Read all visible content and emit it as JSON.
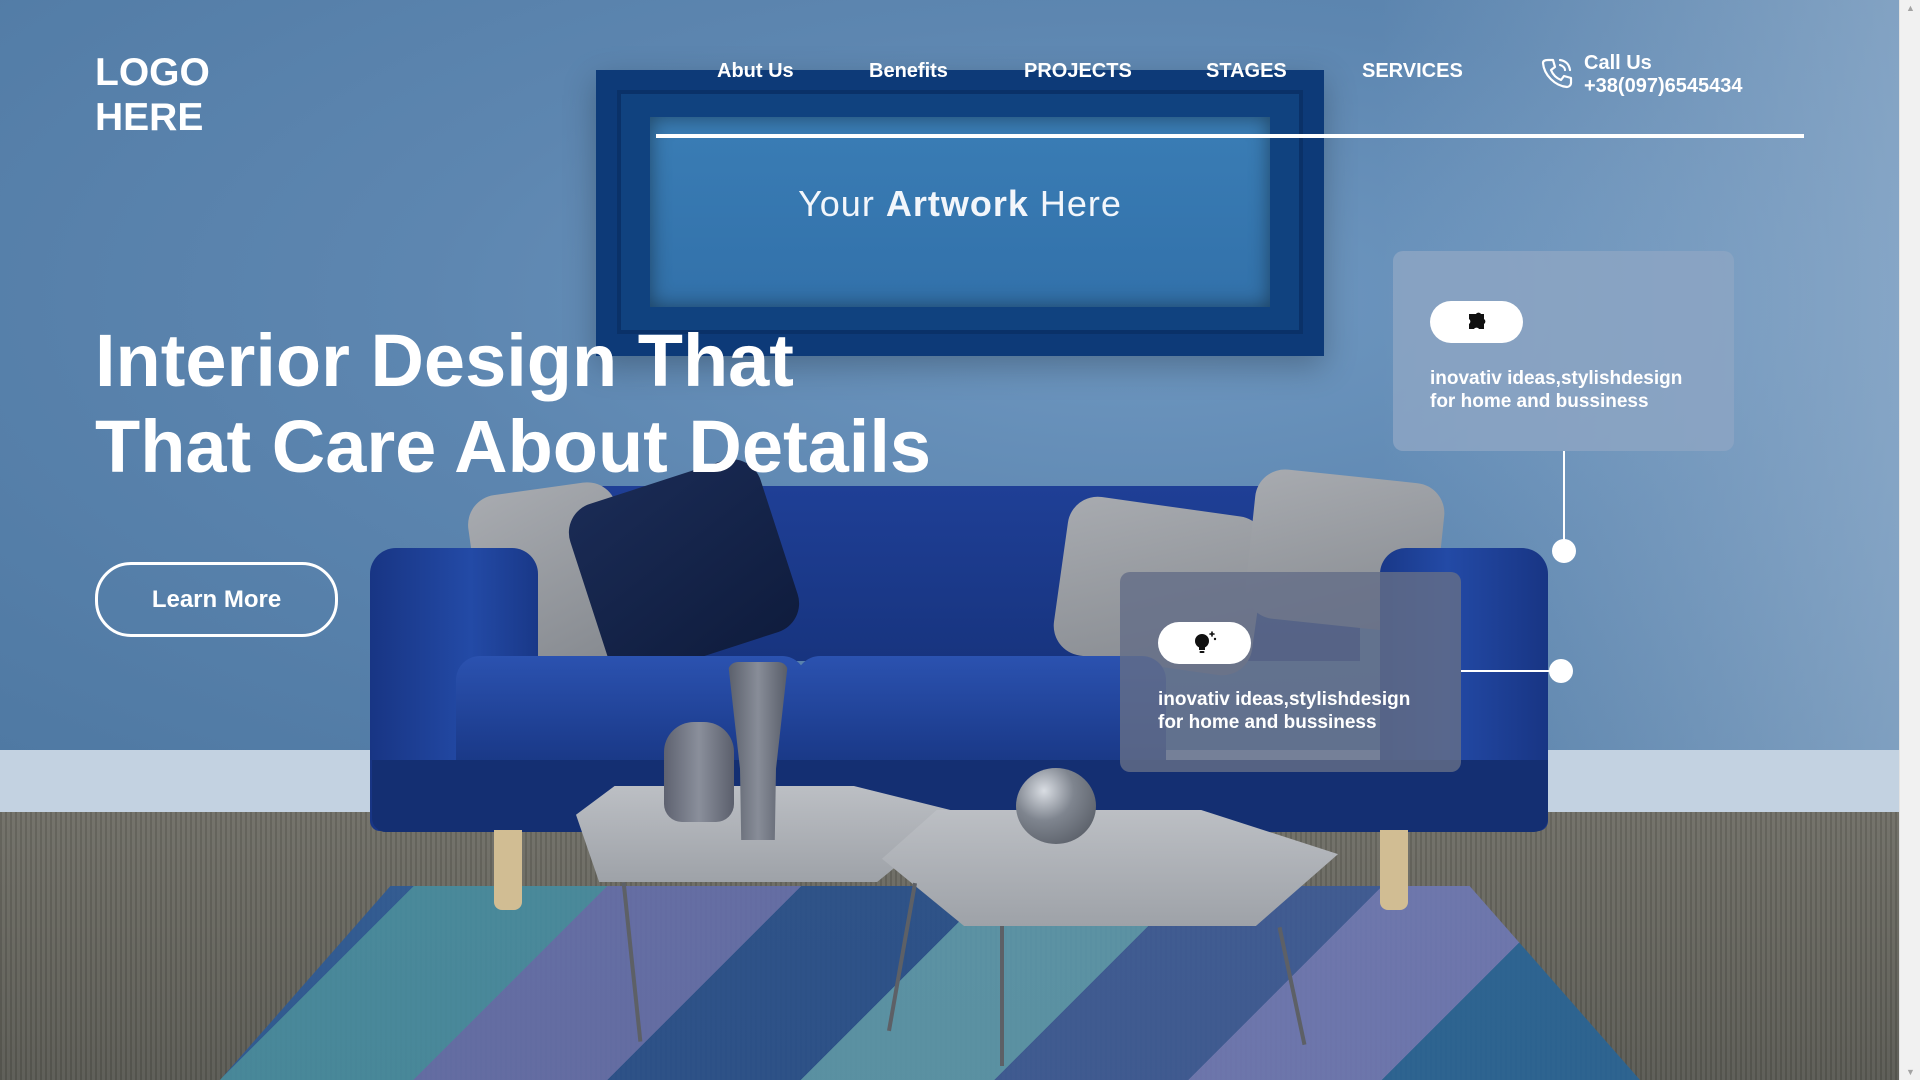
{
  "logo": {
    "line1": "LOGO",
    "line2": "HERE"
  },
  "nav": {
    "items": [
      {
        "label": "Abut Us"
      },
      {
        "label": "Benefits"
      },
      {
        "label": "PROJECTS"
      },
      {
        "label": "STAGES"
      },
      {
        "label": "SERVICES"
      }
    ],
    "call": {
      "label": "Call Us",
      "phone": "+38(097)6545434",
      "icon": "phone-icon"
    }
  },
  "artwork": {
    "prefix": "Your",
    "bold": "Artwork",
    "suffix": "Here"
  },
  "hero": {
    "line1": "Interior Design That",
    "line2": "That Care About Details",
    "button_label": "Learn More"
  },
  "cards": [
    {
      "icon": "puzzle-icon",
      "line1": "inovativ ideas,stylishdesign",
      "line2": "for home and bussiness"
    },
    {
      "icon": "lightbulb-icon",
      "line1": "inovativ ideas,stylishdesign",
      "line2": "for home and bussiness"
    }
  ],
  "colors": {
    "accent": "#ffffff",
    "frame": "#0d3a78",
    "sofa": "#1f3f96"
  }
}
